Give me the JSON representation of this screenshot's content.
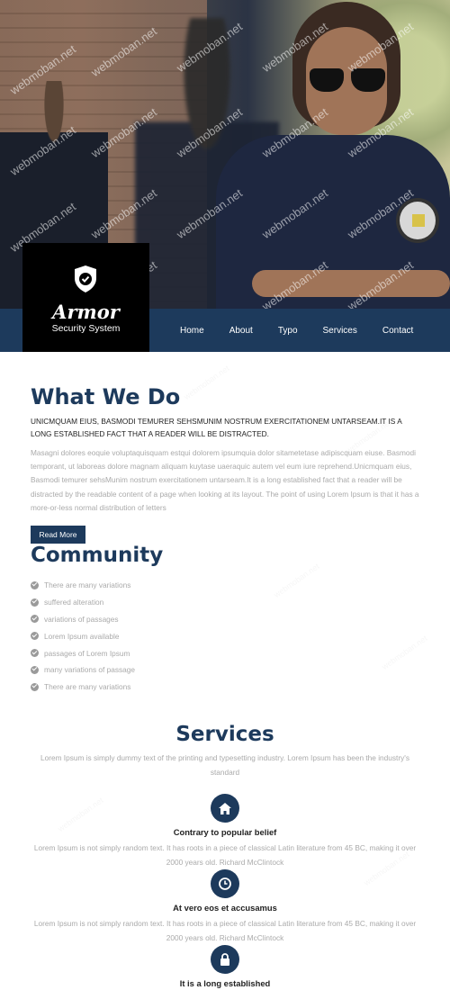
{
  "brand": {
    "name": "Armor",
    "tagline": "Security System"
  },
  "nav": {
    "items": [
      "Home",
      "About",
      "Typo",
      "Services",
      "Contact"
    ]
  },
  "hero": {
    "watermark": "webmoban.net"
  },
  "what_we_do": {
    "title": "What We Do",
    "lead": "UNICMQUAM EIUS, BASMODI TEMURER SEHSMUNIM NOSTRUM EXERCITATIONEM UNTARSEAM.IT IS A LONG ESTABLISHED FACT THAT A READER WILL BE DISTRACTED.",
    "body": "Masagni dolores eoquie voluptaquisquam estqui dolorem ipsumquia dolor sitametetase adipiscquam eiuse. Basmodi temporant, ut laboreas dolore magnam aliquam kuytase uaeraquic autem vel eum iure reprehend.Unicmquam eius, Basmodi temurer sehsMunim nostrum exercitationem untarseam.It is a long established fact that a reader will be distracted by the readable content of a page when looking at its layout. The point of using Lorem Ipsum is that it has a more-or-less normal distribution of letters",
    "button": "Read More"
  },
  "community": {
    "title": "Community",
    "items": [
      "There are many variations",
      "suffered alteration",
      "variations of passages",
      "Lorem Ipsum available",
      "passages of Lorem Ipsum",
      "many variations of passage",
      "There are many variations"
    ]
  },
  "services": {
    "title": "Services",
    "lead": "Lorem Ipsum is simply dummy text of the printing and typesetting industry. Lorem Ipsum has been the industry's standard",
    "items": [
      {
        "icon": "home-icon",
        "title": "Contrary to popular belief",
        "desc": "Lorem Ipsum is not simply random text. It has roots in a piece of classical Latin literature from 45 BC, making it over 2000 years old. Richard McClintock"
      },
      {
        "icon": "clock-icon",
        "title": "At vero eos et accusamus",
        "desc": "Lorem Ipsum is not simply random text. It has roots in a piece of classical Latin literature from 45 BC, making it over 2000 years old. Richard McClintock"
      },
      {
        "icon": "lock-icon",
        "title": "It is a long established",
        "desc": ""
      }
    ]
  },
  "colors": {
    "primary": "#1d3a5c",
    "logo_bg": "#000000",
    "muted_text": "#aaaaaa"
  }
}
